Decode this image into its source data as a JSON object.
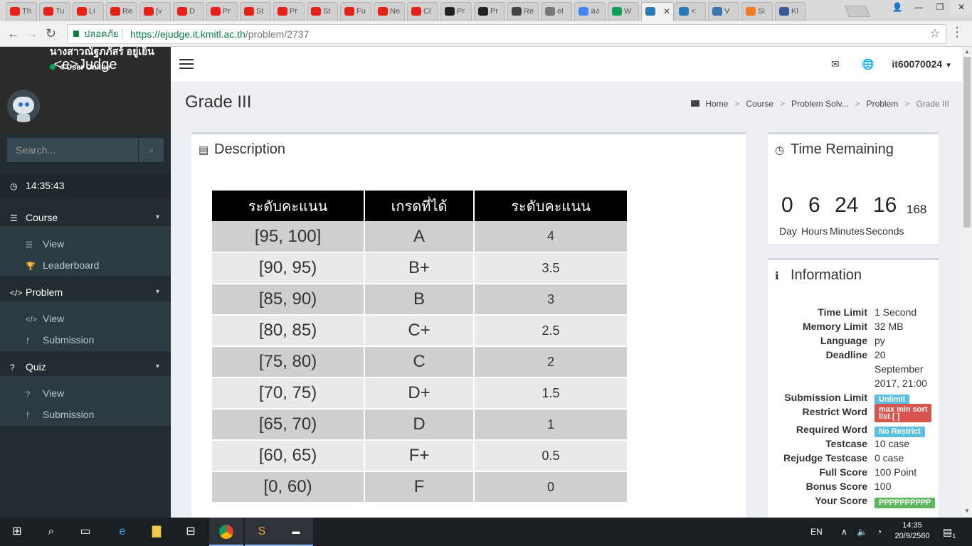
{
  "browser": {
    "tabs": [
      {
        "label": "Th",
        "color": "#e62117"
      },
      {
        "label": "Tu",
        "color": "#e62117"
      },
      {
        "label": "Li",
        "color": "#e62117"
      },
      {
        "label": "Re",
        "color": "#e62117"
      },
      {
        "label": "[v",
        "color": "#e62117"
      },
      {
        "label": "D",
        "color": "#e62117"
      },
      {
        "label": "Pr",
        "color": "#e62117"
      },
      {
        "label": "St",
        "color": "#e62117"
      },
      {
        "label": "Pr",
        "color": "#e62117"
      },
      {
        "label": "St",
        "color": "#e62117"
      },
      {
        "label": "Fu",
        "color": "#e62117"
      },
      {
        "label": "Ne",
        "color": "#e62117"
      },
      {
        "label": "Cl",
        "color": "#e62117"
      },
      {
        "label": "Pr",
        "color": "#222222"
      },
      {
        "label": "Pr",
        "color": "#222222"
      },
      {
        "label": "Re",
        "color": "#444444"
      },
      {
        "label": "el",
        "color": "#777777"
      },
      {
        "label": "ลง",
        "color": "#4285f4"
      },
      {
        "label": "W",
        "color": "#0f9d58"
      },
      {
        "label": "",
        "color": "#2a7ab8"
      },
      {
        "label": "<",
        "color": "#2a7ab8"
      },
      {
        "label": "V",
        "color": "#3776ab"
      },
      {
        "label": "Si",
        "color": "#f47b20"
      },
      {
        "label": "Kl",
        "color": "#3b5998"
      }
    ],
    "secure_label": "ปลอดภัย",
    "url_host": "https://ejudge.it.kmitl.ac.th",
    "url_path": "/problem/2737",
    "window_controls": {
      "user": "👤",
      "minimize": "—",
      "restore": "❐",
      "close": "✕"
    }
  },
  "sidebar": {
    "logo": "<e>Judge",
    "user_name": "นางสาวณัฐภภัสร์ อยู่เย็น",
    "online": "4 User Online",
    "search_placeholder": "Search...",
    "clock": "14:35:43",
    "sections": [
      {
        "label": "Course",
        "items": [
          "View",
          "Leaderboard"
        ]
      },
      {
        "label": "Problem",
        "items": [
          "View",
          "Submission"
        ]
      },
      {
        "label": "Quiz",
        "items": [
          "View",
          "Submission"
        ]
      }
    ]
  },
  "header": {
    "username": "it60070024"
  },
  "page": {
    "title": "Grade III",
    "breadcrumb": [
      "Home",
      "Course",
      "Problem Solv...",
      "Problem",
      "Grade III"
    ]
  },
  "description": {
    "title": "Description",
    "table": {
      "headers": [
        "ระดับคะแนน",
        "เกรดที่ได้",
        "ระดับคะแนน"
      ],
      "rows": [
        [
          "[95, 100]",
          "A",
          "4"
        ],
        [
          "[90, 95)",
          "B+",
          "3.5"
        ],
        [
          "[85, 90)",
          "B",
          "3"
        ],
        [
          "[80, 85)",
          "C+",
          "2.5"
        ],
        [
          "[75, 80)",
          "C",
          "2"
        ],
        [
          "[70, 75)",
          "D+",
          "1.5"
        ],
        [
          "[65, 70)",
          "D",
          "1"
        ],
        [
          "[60, 65)",
          "F+",
          "0.5"
        ],
        [
          "[0, 60)",
          "F",
          "0"
        ]
      ]
    }
  },
  "time_remaining": {
    "title": "Time Remaining",
    "day": "0",
    "hours": "6",
    "minutes": "24",
    "seconds": "16",
    "ms": "168",
    "labels": {
      "day": "Day",
      "hours": "Hours",
      "minutes": "Minutes",
      "seconds": "Seconds"
    }
  },
  "information": {
    "title": "Information",
    "time_limit": {
      "key": "Time Limit",
      "value": "1 Second"
    },
    "memory_limit": {
      "key": "Memory Limit",
      "value": "32 MB"
    },
    "language": {
      "key": "Language",
      "value": "py"
    },
    "deadline": {
      "key": "Deadline",
      "value_1": "20",
      "value_2": "September",
      "value_3": "2017, 21:00"
    },
    "submission_limit": {
      "key": "Submission Limit",
      "value": "Unlimit",
      "color": "#5bc0de"
    },
    "restrict_word": {
      "key": "Restrict Word",
      "value_1": "max min sort",
      "value_2": "list [ ]",
      "color": "#d9534f"
    },
    "required_word": {
      "key": "Required Word",
      "value": "No Restrict",
      "color": "#5bc0de"
    },
    "testcase": {
      "key": "Testcase",
      "value": "10 case"
    },
    "rejudge_testcase": {
      "key": "Rejudge Testcase",
      "value": "0 case"
    },
    "full_score": {
      "key": "Full Score",
      "value": "100 Point"
    },
    "bonus_score": {
      "key": "Bonus Score",
      "value": "100"
    },
    "your_score": {
      "key": "Your Score",
      "value": "PPPPPPPPPP",
      "color": "#5cb85c"
    }
  },
  "taskbar": {
    "language": "EN",
    "time": "14:35",
    "date": "20/9/2560",
    "notifications": "1"
  }
}
